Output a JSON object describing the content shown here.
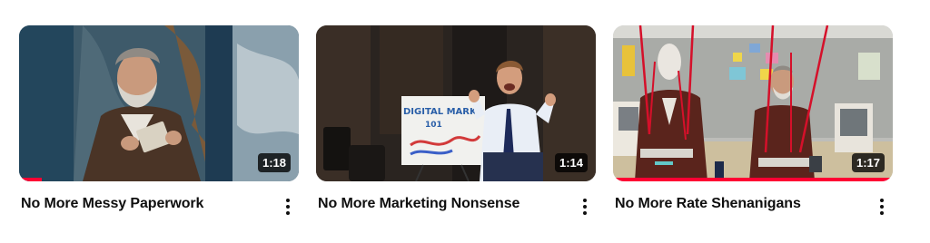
{
  "videos": [
    {
      "title": "No More Messy Paperwork",
      "duration": "1:18",
      "watched_fraction": 0.08,
      "menu_icon": "more-vertical-icon"
    },
    {
      "title": "No More Marketing Nonsense",
      "duration": "1:14",
      "watched_fraction": 0,
      "menu_icon": "more-vertical-icon",
      "whiteboard_text_1": "DIGITAL MARK",
      "whiteboard_text_2": "101"
    },
    {
      "title": "No More Rate Shenanigans",
      "duration": "1:17",
      "watched_fraction": 1.0,
      "menu_icon": "more-vertical-icon"
    }
  ],
  "colors": {
    "progress": "#ff0033",
    "title": "#0f0f0f"
  }
}
